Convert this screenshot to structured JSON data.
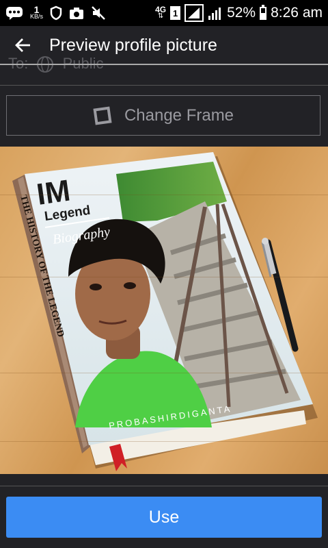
{
  "status_bar": {
    "speed_value": "1",
    "speed_unit": "KB/s",
    "network": "4G",
    "sim_slot": "1",
    "battery": "52%",
    "time": "8:26 am"
  },
  "app_bar": {
    "title": "Preview profile picture"
  },
  "audience": {
    "prefix": "To:",
    "value": "Public"
  },
  "change_frame": {
    "label": "Change Frame"
  },
  "preview": {
    "logo_text": "IM",
    "logo_subtitle": "Legend",
    "cover_subtitle": "Biography",
    "spine_title": "THE HISTORY OF THE LEGEND",
    "watermark": "PROBASHIRDIGANTA"
  },
  "use_button": {
    "label": "Use"
  },
  "colors": {
    "background": "#222226",
    "accent": "#3b8cf3",
    "status_bar": "#000000"
  }
}
